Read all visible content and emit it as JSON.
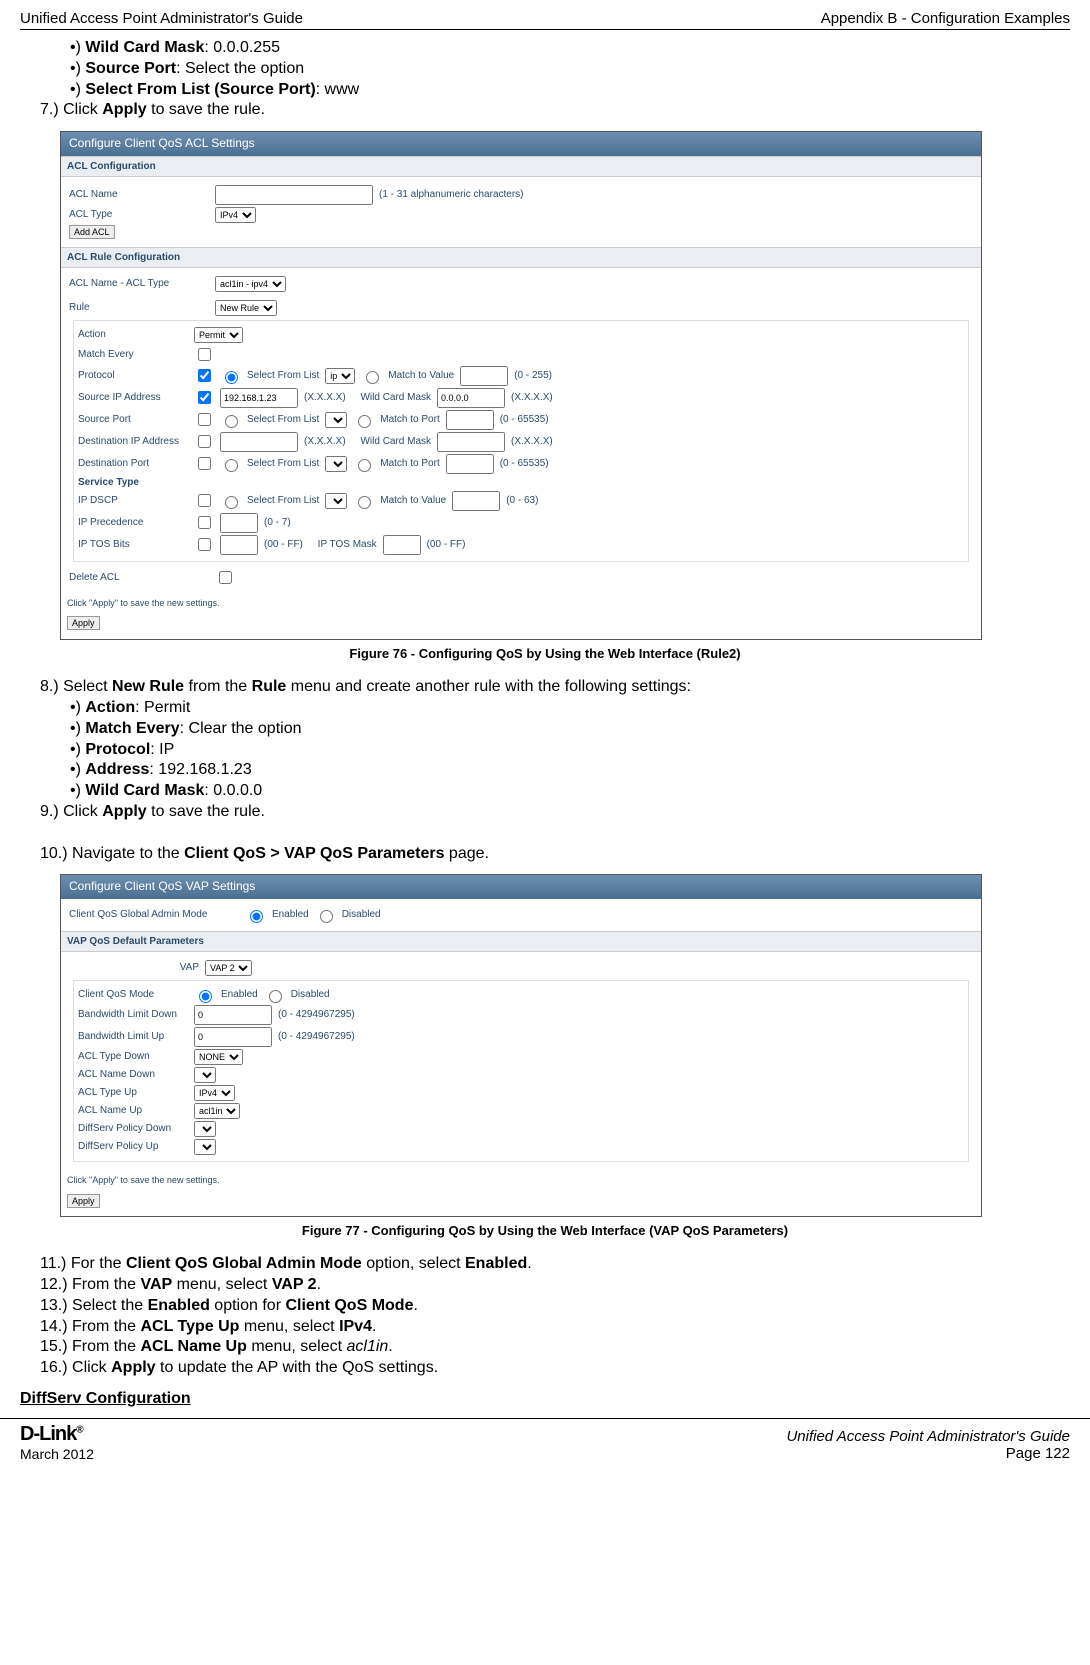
{
  "header": {
    "left": "Unified Access Point Administrator's Guide",
    "right": "Appendix B - Configuration Examples"
  },
  "top_bullets": {
    "b1_label": "Wild Card Mask",
    "b1_value": ": 0.0.0.255",
    "b2_label": "Source Port",
    "b2_value": ": Select the option",
    "b3_label": "Select From List (Source Port)",
    "b3_value": ": www"
  },
  "step7": {
    "num": "7.)  ",
    "pre": "Click ",
    "bold": "Apply",
    "post": " to save the rule."
  },
  "fig76": {
    "title_bar": "Configure Client QoS ACL Settings",
    "s1": "ACL Configuration",
    "acl_name_lbl": "ACL Name",
    "acl_name_hint": "(1 - 31 alphanumeric characters)",
    "acl_type_lbl": "ACL Type",
    "acl_type_val": "IPv4",
    "add_btn": "Add ACL",
    "s2": "ACL Rule Configuration",
    "acl_nt_lbl": "ACL Name - ACL Type",
    "acl_nt_val": "acl1in - ipv4",
    "rule_lbl": "Rule",
    "rule_val": "New Rule",
    "r_action_lbl": "Action",
    "r_action_val": "Permit",
    "r_match_lbl": "Match Every",
    "r_proto_lbl": "Protocol",
    "r_proto_sel": "Select From List",
    "r_proto_val": "ip",
    "r_proto_mt": "Match to Value",
    "r_proto_hint": "(0 - 255)",
    "r_sip_lbl": "Source IP Address",
    "r_sip_val": "192.168.1.23",
    "r_sip_fmt": "(X.X.X.X)",
    "r_sip_wcm": "Wild Card Mask",
    "r_sip_wcm_val": "0.0.0.0",
    "r_sp_lbl": "Source Port",
    "r_sp_sel": "Select From List",
    "r_sp_mt": "Match to Port",
    "r_sp_hint": "(0 - 65535)",
    "r_dip_lbl": "Destination IP Address",
    "r_dip_fmt": "(X.X.X.X)",
    "r_dip_wcm": "Wild Card Mask",
    "r_dp_lbl": "Destination Port",
    "r_dp_sel": "Select From List",
    "r_dp_mt": "Match to Port",
    "r_dp_hint": "(0 - 65535)",
    "r_svc_lbl": "Service Type",
    "r_dscp_lbl": "IP DSCP",
    "r_dscp_sel": "Select From List",
    "r_dscp_mt": "Match to Value",
    "r_dscp_hint": "(0 - 63)",
    "r_prec_lbl": "IP Precedence",
    "r_prec_hint": "(0 - 7)",
    "r_tos_lbl": "IP TOS Bits",
    "r_tos_h1": "(00 - FF)",
    "r_tos_mask": "IP TOS Mask",
    "r_tos_h2": "(00 - FF)",
    "del_lbl": "Delete ACL",
    "note": "Click \"Apply\" to save the new settings.",
    "apply": "Apply",
    "caption": "Figure 76 - Configuring QoS by Using the Web Interface (Rule2)"
  },
  "step8": {
    "num": "8.)  ",
    "pre": "Select ",
    "b1": "New Rule",
    "mid": " from the ",
    "b2": "Rule",
    "post": " menu and create another rule with the following settings:",
    "items": {
      "a_lbl": "Action",
      "a_val": ": Permit",
      "m_lbl": "Match Every",
      "m_val": ": Clear the option",
      "p_lbl": "Protocol",
      "p_val": ": IP",
      "ad_lbl": "Address",
      "ad_val": ": 192.168.1.23",
      "w_lbl": "Wild Card Mask",
      "w_val": ": 0.0.0.0"
    }
  },
  "step9": {
    "num": "9.)  ",
    "pre": "Click ",
    "bold": "Apply",
    "post": " to save the rule."
  },
  "step10": {
    "num": "10.)  ",
    "pre": "Navigate to the ",
    "bold": "Client QoS > VAP QoS Parameters",
    "post": " page."
  },
  "fig77": {
    "title_bar": "Configure Client QoS VAP Settings",
    "gam_lbl": "Client QoS Global Admin Mode",
    "en": "Enabled",
    "dis": "Disabled",
    "s1": "VAP QoS Default Parameters",
    "vap_lbl": "VAP",
    "vap_val": "VAP 2",
    "cqm_lbl": "Client QoS Mode",
    "bld_lbl": "Bandwidth Limit Down",
    "bld_val": "0",
    "bld_hint": "(0 - 4294967295)",
    "blu_lbl": "Bandwidth Limit Up",
    "blu_val": "0",
    "blu_hint": "(0 - 4294967295)",
    "atd_lbl": "ACL Type Down",
    "atd_val": "NONE",
    "and_lbl": "ACL Name Down",
    "atu_lbl": "ACL Type Up",
    "atu_val": "IPv4",
    "anu_lbl": "ACL Name Up",
    "anu_val": "acl1in",
    "dpd_lbl": "DiffServ Policy Down",
    "dpu_lbl": "DiffServ Policy Up",
    "note": "Click \"Apply\" to save the new settings.",
    "apply": "Apply",
    "caption": "Figure 77 - Configuring QoS by Using the Web Interface (VAP QoS Parameters)"
  },
  "step11": {
    "num": "11.)  ",
    "pre": "For the ",
    "b1": "Client QoS Global Admin Mode",
    "mid": " option, select ",
    "b2": "Enabled",
    "post": "."
  },
  "step12": {
    "num": "12.)  ",
    "pre": "From the ",
    "b1": "VAP",
    "mid": " menu, select ",
    "b2": "VAP 2",
    "post": "."
  },
  "step13": {
    "num": "13.)  ",
    "pre": "Select the ",
    "b1": "Enabled",
    "mid": " option for ",
    "b2": "Client QoS Mode",
    "post": "."
  },
  "step14": {
    "num": "14.)  ",
    "pre": "From the ",
    "b1": "ACL Type Up",
    "mid": " menu, select ",
    "b2": "IPv4",
    "post": "."
  },
  "step15": {
    "num": "15.)  ",
    "pre": "From the ",
    "b1": "ACL Name Up",
    "mid": " menu, select ",
    "i": "acl1in",
    "post": "."
  },
  "step16": {
    "num": "16.)  ",
    "pre": "Click ",
    "b1": "Apply",
    "post": " to update the AP with the QoS settings."
  },
  "diffserv_heading": "DiffServ Configuration",
  "footer": {
    "brand": "D-Link",
    "date": "March 2012",
    "title": "Unified Access Point Administrator's Guide",
    "page": "Page 122"
  }
}
